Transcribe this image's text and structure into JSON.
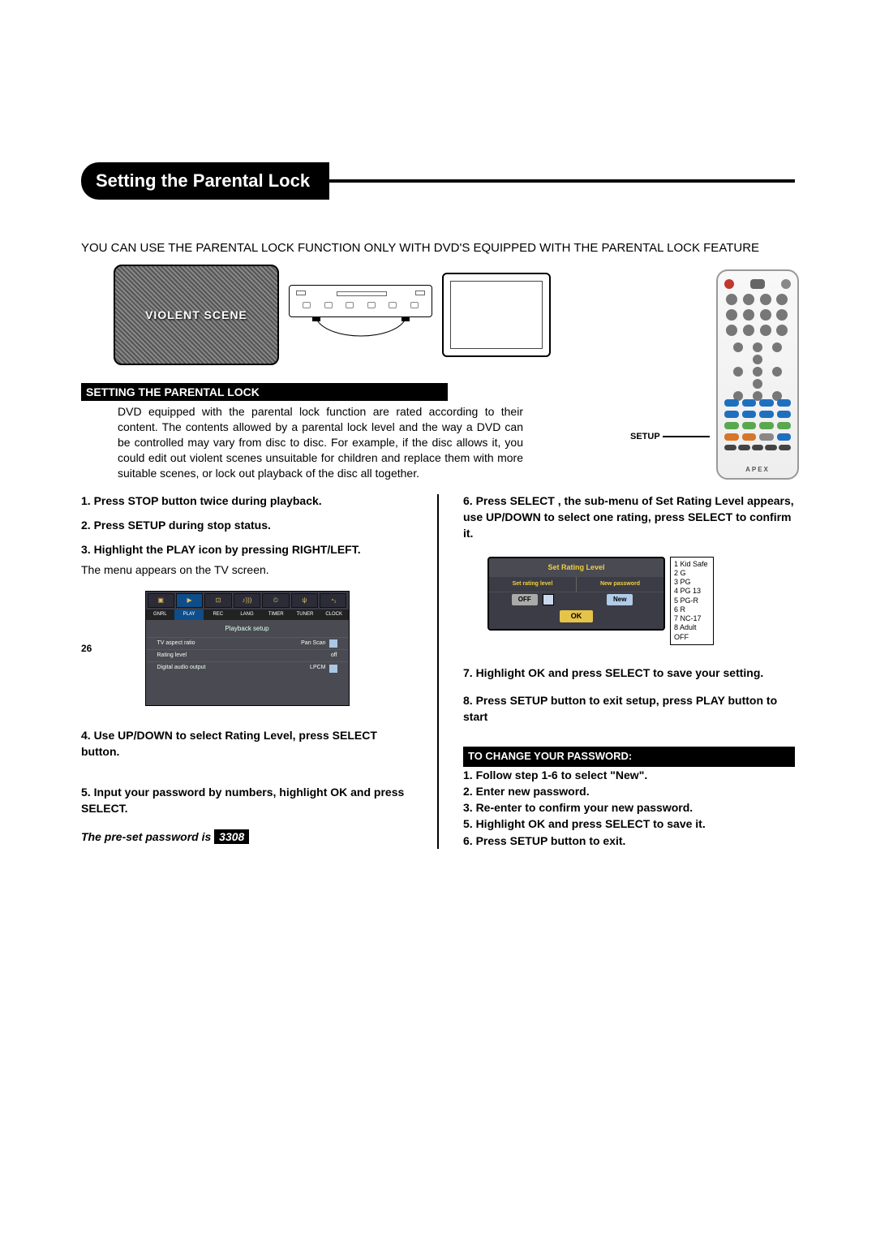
{
  "title": "Setting the Parental Lock",
  "intro": "YOU CAN USE THE PARENTAL LOCK FUNCTION ONLY WITH DVD'S EQUIPPED WITH THE PARENTAL LOCK FEATURE",
  "tv_label": "VIOLENT SCENE",
  "section_heading": "SETTING THE PARENTAL LOCK",
  "section_body": "DVD equipped with the parental lock function are rated according to their content.  The contents allowed by a parental lock level and the way a DVD can be controlled may vary from disc to disc.  For example, if the disc allows it, you could edit out violent scenes unsuitable for children and replace them with more suitable scenes, or lock out playback of the disc all together.",
  "remote": {
    "setup_label": "SETUP",
    "logo": "APEX"
  },
  "left": {
    "s1": "1. Press STOP button twice during playback.",
    "s2": "2. Press SETUP during stop status.",
    "s3": "3. Highlight the PLAY icon by pressing RIGHT/LEFT.",
    "s3_note": "The menu appears on the TV screen.",
    "s4": "4. Use UP/DOWN to select Rating Level, press SELECT button.",
    "s5": "5. Input your password by numbers, highlight OK and press SELECT.",
    "preset_prefix": "The pre-set password is  ",
    "preset_pw": "3308"
  },
  "osd": {
    "tabs": [
      "GNRL",
      "PLAY",
      "REC",
      "LANG",
      "TIMER",
      "TUNER",
      "CLOCK"
    ],
    "title": "Playback setup",
    "rows": [
      {
        "l": "TV aspect ratio",
        "r": "Pan Scan"
      },
      {
        "l": "Rating level",
        "r": "off"
      },
      {
        "l": "Digital audio output",
        "r": "LPCM"
      }
    ]
  },
  "right": {
    "s6": "6. Press SELECT , the sub-menu of Set Rating Level appears, use UP/DOWN to select one rating, press SELECT to confirm it.",
    "s7": "7. Highlight OK and press SELECT to save your setting.",
    "s8": "8. Press SETUP button to exit setup, press PLAY button to start",
    "subheading": "TO CHANGE YOUR PASSWORD:",
    "c1": "1. Follow step 1-6 to select \"New\".",
    "c2": "2. Enter new password.",
    "c3": "3. Re-enter to confirm your new password.",
    "c5": "5. Highlight OK and press SELECT to save it.",
    "c6": "6. Press SETUP button to exit."
  },
  "rating_osd": {
    "title": "Set Rating Level",
    "left_label": "Set rating level",
    "right_label": "New password",
    "off": "OFF",
    "new": "New",
    "ok": "OK"
  },
  "rating_list": [
    "1  Kid Safe",
    "2  G",
    "3  PG",
    "4  PG 13",
    "5  PG-R",
    "6  R",
    "7  NC-17",
    "8  Adult",
    "OFF"
  ],
  "page_number": "26"
}
